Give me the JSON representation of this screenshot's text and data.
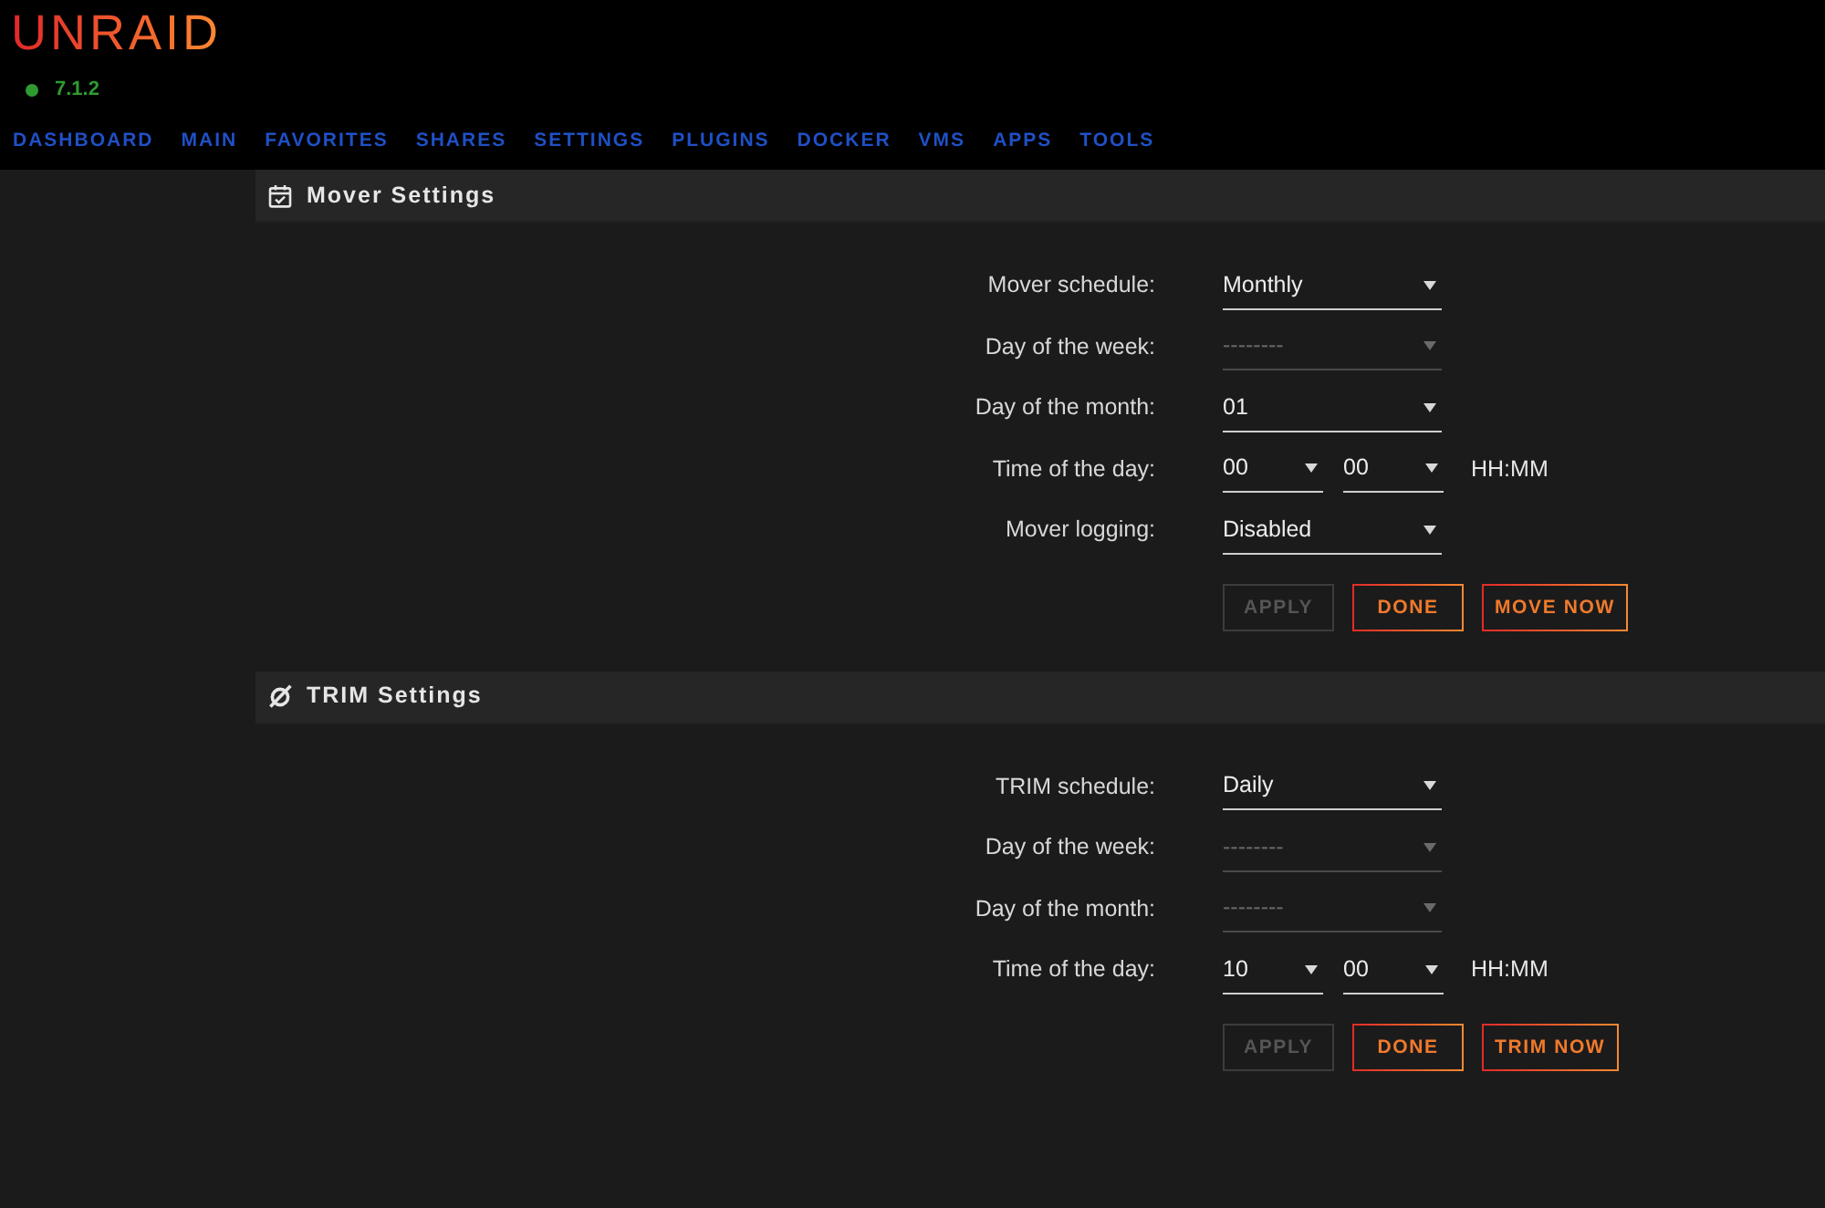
{
  "header": {
    "logo": "UNRAID",
    "version": "7.1.2",
    "nav": [
      "DASHBOARD",
      "MAIN",
      "FAVORITES",
      "SHARES",
      "SETTINGS",
      "PLUGINS",
      "DOCKER",
      "VMS",
      "APPS",
      "TOOLS"
    ]
  },
  "sections": [
    {
      "title": "Mover Settings",
      "fields": [
        {
          "kind": "select",
          "label": "Mover schedule:",
          "value": "Monthly",
          "disabled": false
        },
        {
          "kind": "select",
          "label": "Day of the week:",
          "value": "--------",
          "disabled": true
        },
        {
          "kind": "select",
          "label": "Day of the month:",
          "value": "01",
          "disabled": false
        },
        {
          "kind": "time",
          "label": "Time of the day:",
          "hour": "00",
          "minute": "00",
          "format": "HH:MM"
        },
        {
          "kind": "select",
          "label": "Mover logging:",
          "value": "Disabled",
          "disabled": false
        }
      ],
      "buttons": [
        {
          "label": "APPLY",
          "disabled": true
        },
        {
          "label": "DONE",
          "disabled": false
        },
        {
          "label": "MOVE NOW",
          "disabled": false
        }
      ]
    },
    {
      "title": "TRIM Settings",
      "fields": [
        {
          "kind": "select",
          "label": "TRIM schedule:",
          "value": "Daily",
          "disabled": false
        },
        {
          "kind": "select",
          "label": "Day of the week:",
          "value": "--------",
          "disabled": true
        },
        {
          "kind": "select",
          "label": "Day of the month:",
          "value": "--------",
          "disabled": true
        },
        {
          "kind": "time",
          "label": "Time of the day:",
          "hour": "10",
          "minute": "00",
          "format": "HH:MM"
        }
      ],
      "buttons": [
        {
          "label": "APPLY",
          "disabled": true
        },
        {
          "label": "DONE",
          "disabled": false
        },
        {
          "label": "TRIM NOW",
          "disabled": false
        }
      ]
    }
  ]
}
